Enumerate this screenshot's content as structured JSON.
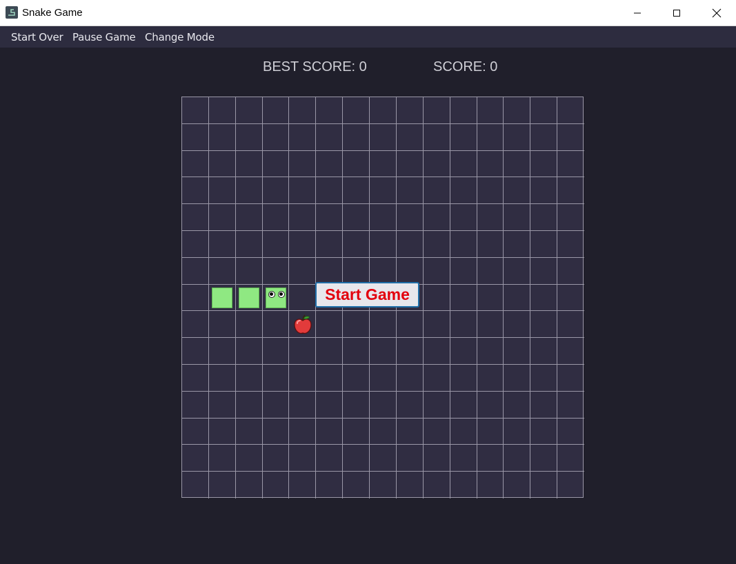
{
  "window": {
    "title": "Snake Game",
    "icon": "snake-app-icon",
    "controls": [
      "minimize-icon",
      "maximize-icon",
      "close-icon"
    ]
  },
  "menu": {
    "items": [
      {
        "label": "Start Over"
      },
      {
        "label": "Pause Game"
      },
      {
        "label": "Change Mode"
      }
    ]
  },
  "scores": {
    "best": "BEST SCORE: 0",
    "current": "SCORE: 0"
  },
  "board": {
    "columns": 15,
    "rows": 15,
    "snake": {
      "head": {
        "col": 3,
        "row": 7
      },
      "body": [
        {
          "col": 2,
          "row": 7
        },
        {
          "col": 1,
          "row": 7
        }
      ],
      "color": "#8fe882"
    },
    "food": {
      "type": "apple-icon",
      "col": 4,
      "row": 8,
      "color": "#e23b3b"
    }
  },
  "start_button": {
    "label": "Start Game",
    "text_color": "#e3000d"
  },
  "colors": {
    "background": "#201f2b",
    "menubar": "#2d2c3f",
    "board": "#302d42",
    "grid_lines": "#9b98a8"
  }
}
